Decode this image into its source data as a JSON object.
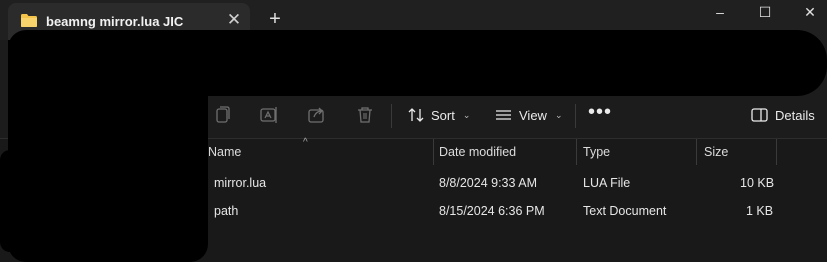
{
  "tab": {
    "title": "beamng mirror.lua JIC",
    "folder_icon": "folder-icon",
    "close_icon": "close-icon"
  },
  "new_tab": {
    "label": "+"
  },
  "window": {
    "minimize": "–",
    "maximize": "☐",
    "close": "✕"
  },
  "toolbar": {
    "sort_label": "Sort",
    "view_label": "View",
    "more_label": "•••",
    "details_label": "Details",
    "icons": [
      "copy-icon",
      "rename-icon",
      "share-icon",
      "delete-icon"
    ]
  },
  "columns": {
    "name": "Name",
    "date": "Date modified",
    "type": "Type",
    "size": "Size"
  },
  "files": [
    {
      "name": "mirror.lua",
      "date": "8/8/2024 9:33 AM",
      "type": "LUA File",
      "size": "10 KB"
    },
    {
      "name": "path",
      "date": "8/15/2024 6:36 PM",
      "type": "Text Document",
      "size": "1 KB"
    }
  ],
  "colors": {
    "accent": "#f3c34a",
    "background": "#191919",
    "titlebar": "#202020"
  }
}
